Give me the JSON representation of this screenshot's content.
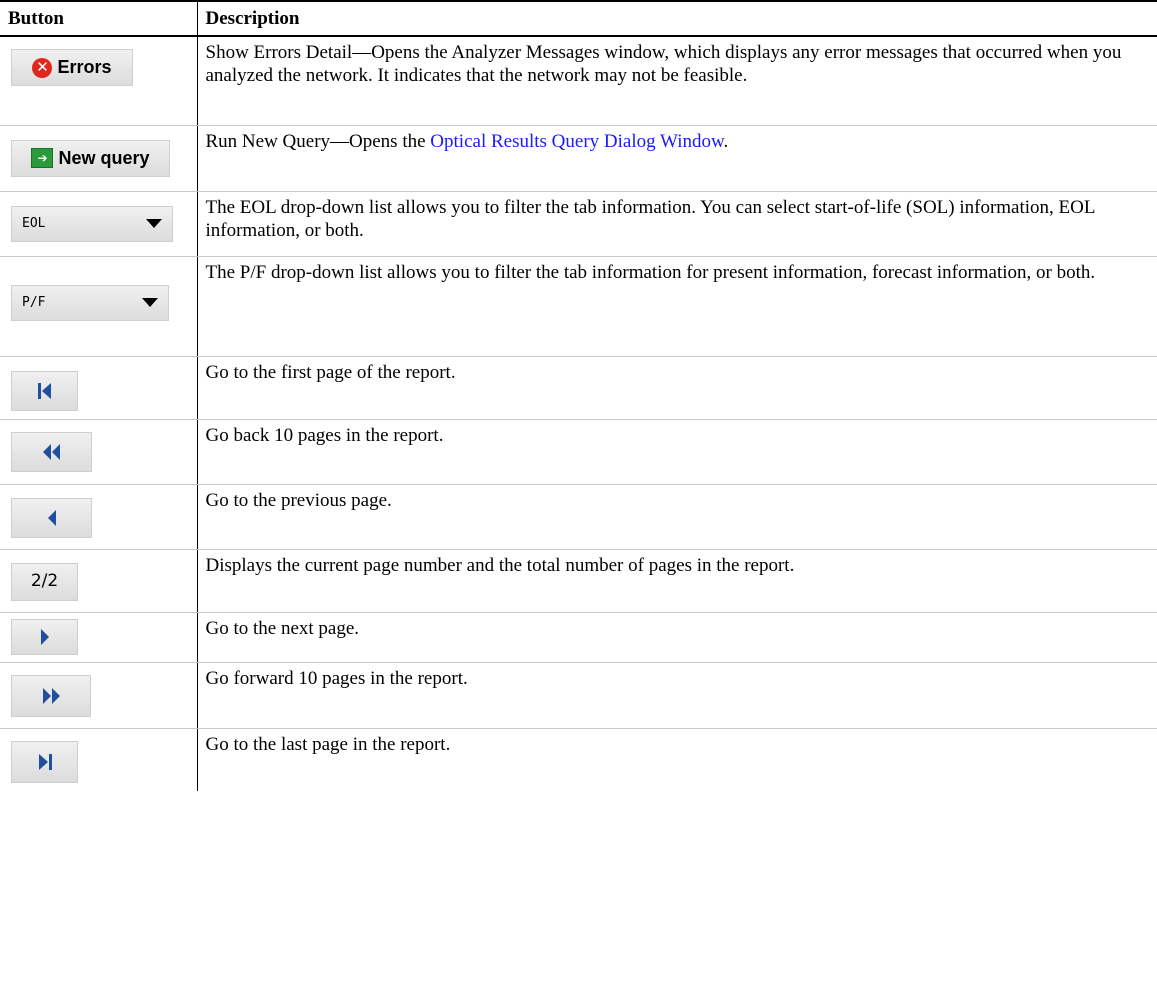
{
  "header": {
    "col_button": "Button",
    "col_description": "Description"
  },
  "rows": [
    {
      "button_label": "Errors",
      "button_icon": "error-icon",
      "desc": "Show Errors Detail—Opens the Analyzer Messages window, which displays any error messages that occurred when you analyzed the network. It indicates that the network may not be feasible."
    },
    {
      "button_label": "New query",
      "button_icon": "new-query-icon",
      "desc_prefix": "Run New Query—Opens the ",
      "desc_link": "Optical Results Query Dialog Window",
      "desc_suffix": "."
    },
    {
      "button_label": "EOL",
      "button_icon": "chevron-down-icon",
      "desc": "The EOL drop-down list allows you to filter the tab information. You can select start-of-life (SOL) information, EOL information, or both."
    },
    {
      "button_label": "P/F",
      "button_icon": "chevron-down-icon",
      "desc": "The P/F drop-down list allows you to filter the tab information for present information, forecast information, or both."
    },
    {
      "button_icon": "first-page-icon",
      "desc": "Go to the first page of the report."
    },
    {
      "button_icon": "back-10-pages-icon",
      "desc": "Go back 10 pages in the report."
    },
    {
      "button_icon": "previous-page-icon",
      "desc": "Go to the previous page."
    },
    {
      "button_label": "2/2",
      "button_icon": "page-indicator",
      "desc": "Displays the current page number and the total number of pages in the report."
    },
    {
      "button_icon": "next-page-icon",
      "desc": "Go to the next page."
    },
    {
      "button_icon": "forward-10-pages-icon",
      "desc": "Go forward 10 pages in the report."
    },
    {
      "button_icon": "last-page-icon",
      "desc": "Go to the last page in the report."
    }
  ],
  "colors": {
    "nav_icon": "#1f4f9e",
    "link": "#1a1aff",
    "error": "#e0261d",
    "new_query": "#2a9b3a"
  }
}
